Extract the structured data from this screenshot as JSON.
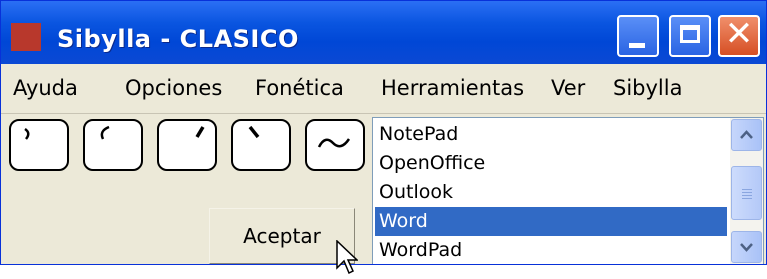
{
  "window": {
    "title": "Sibylla - CLASICO",
    "app_icon": "sibylla-app-icon",
    "controls": [
      "minimize-icon",
      "maximize-icon",
      "close-icon"
    ],
    "colors": {
      "titlebar": "#0a55e0",
      "selection": "#316ac5",
      "close": "#d64f24"
    }
  },
  "menu": {
    "items": [
      {
        "label": "Ayuda"
      },
      {
        "label": "Opciones"
      },
      {
        "label": "Fonética"
      },
      {
        "label": "Herramientas"
      },
      {
        "label": "Ver"
      },
      {
        "label": "Sibylla"
      }
    ]
  },
  "accent_keys": [
    {
      "icon": "acute-accent-icon"
    },
    {
      "icon": "grave-accent-icon"
    },
    {
      "icon": "acute-accent-icon"
    },
    {
      "icon": "grave-accent-icon"
    },
    {
      "icon": "tilde-icon"
    }
  ],
  "accept_button": {
    "label": "Aceptar"
  },
  "app_list": {
    "items": [
      {
        "label": "NotePad",
        "selected": false
      },
      {
        "label": "OpenOffice",
        "selected": false
      },
      {
        "label": "Outlook",
        "selected": false
      },
      {
        "label": "Word",
        "selected": true
      },
      {
        "label": "WordPad",
        "selected": false
      }
    ]
  }
}
